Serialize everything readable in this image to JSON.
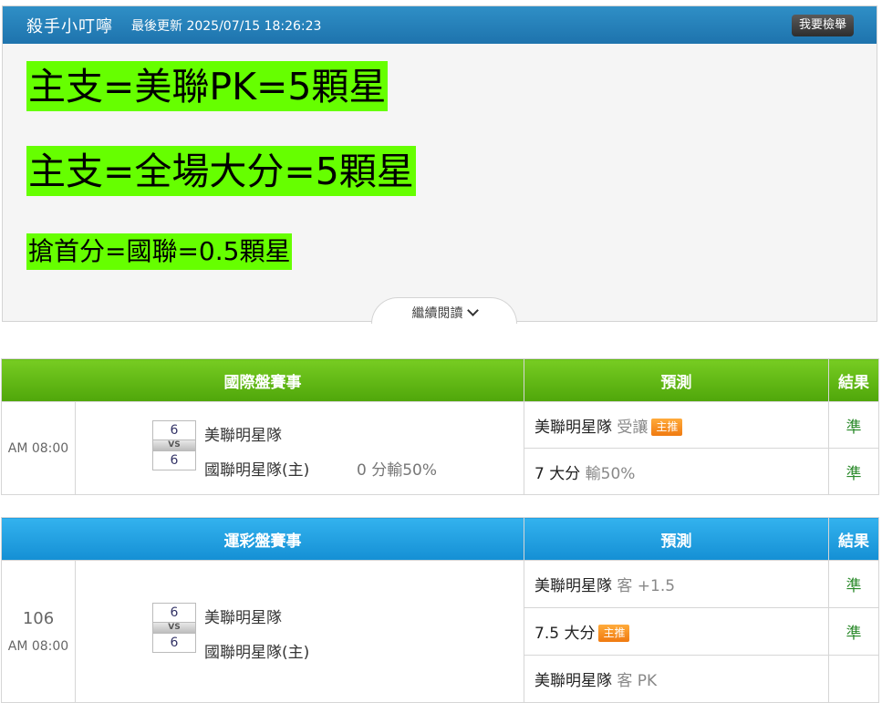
{
  "header": {
    "author": "殺手小叮嚀",
    "updated": "最後更新 2025/07/15 18:26:23",
    "report_button": "我要檢舉"
  },
  "picks": [
    "主支=美聯PK=5顆星",
    "主支=全場大分=5顆星",
    "搶首分=國聯=0.5顆星"
  ],
  "read_more": "繼續閱讀",
  "intl": {
    "header_match": "國際盤賽事",
    "header_pred": "預測",
    "header_result": "結果",
    "time": "AM 08:00",
    "vs": "VS",
    "away": {
      "score": "6",
      "team": "美聯明星隊"
    },
    "home": {
      "score": "6",
      "team": "國聯明星隊(主)",
      "handicap": "0 分輸50%"
    },
    "predictions": [
      {
        "main": "美聯明星隊",
        "sub": "受讓",
        "badge": "主推",
        "result": "準"
      },
      {
        "main": "7 大分",
        "sub": "輸50%",
        "badge": "",
        "result": "準"
      }
    ]
  },
  "lottery": {
    "header_match": "運彩盤賽事",
    "header_pred": "預測",
    "header_result": "結果",
    "game_no": "106",
    "time": "AM 08:00",
    "vs": "VS",
    "away": {
      "score": "6",
      "team": "美聯明星隊"
    },
    "home": {
      "score": "6",
      "team": "國聯明星隊(主)"
    },
    "predictions": [
      {
        "main": "美聯明星隊",
        "sub": "客 +1.5",
        "badge": "",
        "result": "準"
      },
      {
        "main": "7.5 大分",
        "sub": "",
        "badge": "主推",
        "result": "準"
      },
      {
        "main": "美聯明星隊",
        "sub": "客 PK",
        "badge": "",
        "result": ""
      }
    ]
  },
  "colors": {
    "highlight": "#66ff00",
    "green_header": "#5fb514",
    "blue_header": "#1f9fe0",
    "result_ok": "#2b8a2b",
    "badge": "#f5891e"
  }
}
